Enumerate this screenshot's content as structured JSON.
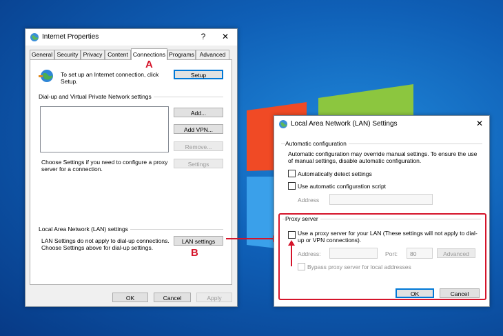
{
  "colors": {
    "annotation_red": "#d5142a",
    "desktop_blue": "#0f5fb6",
    "focus_blue": "#0078d7"
  },
  "internet_properties": {
    "title": "Internet Properties",
    "help": "?",
    "close": "✕",
    "tabs": [
      "General",
      "Security",
      "Privacy",
      "Content",
      "Connections",
      "Programs",
      "Advanced"
    ],
    "active_tab": "Connections",
    "setup_text": "To set up an Internet connection, click Setup.",
    "setup_button": "Setup",
    "dialup_heading": "Dial-up and Virtual Private Network settings",
    "add_button": "Add...",
    "add_vpn_button": "Add VPN...",
    "remove_button": "Remove...",
    "settings_button": "Settings",
    "choose_text": "Choose Settings if you need to configure a proxy server for a connection.",
    "lan_heading": "Local Area Network (LAN) settings",
    "lan_text": "LAN Settings do not apply to dial-up connections. Choose Settings above for dial-up settings.",
    "lan_settings_button": "LAN settings",
    "ok_button": "OK",
    "cancel_button": "Cancel",
    "apply_button": "Apply"
  },
  "lan_dialog": {
    "title": "Local Area Network (LAN) Settings",
    "close": "✕",
    "auto_config_heading": "Automatic configuration",
    "auto_config_text": "Automatic configuration may override manual settings.  To ensure the use of manual settings, disable automatic configuration.",
    "auto_detect_label": "Automatically detect settings",
    "auto_script_label": "Use automatic configuration script",
    "address_label": "Address",
    "proxy_heading": "Proxy server",
    "use_proxy_label": "Use a proxy server for your LAN (These settings will not apply to dial-up or VPN connections).",
    "proxy_address_label": "Address:",
    "port_label": "Port:",
    "port_value": "80",
    "advanced_button": "Advanced",
    "bypass_label": "Bypass proxy server for local addresses",
    "ok_button": "OK",
    "cancel_button": "Cancel"
  },
  "annotations": {
    "a": "A",
    "b": "B"
  }
}
